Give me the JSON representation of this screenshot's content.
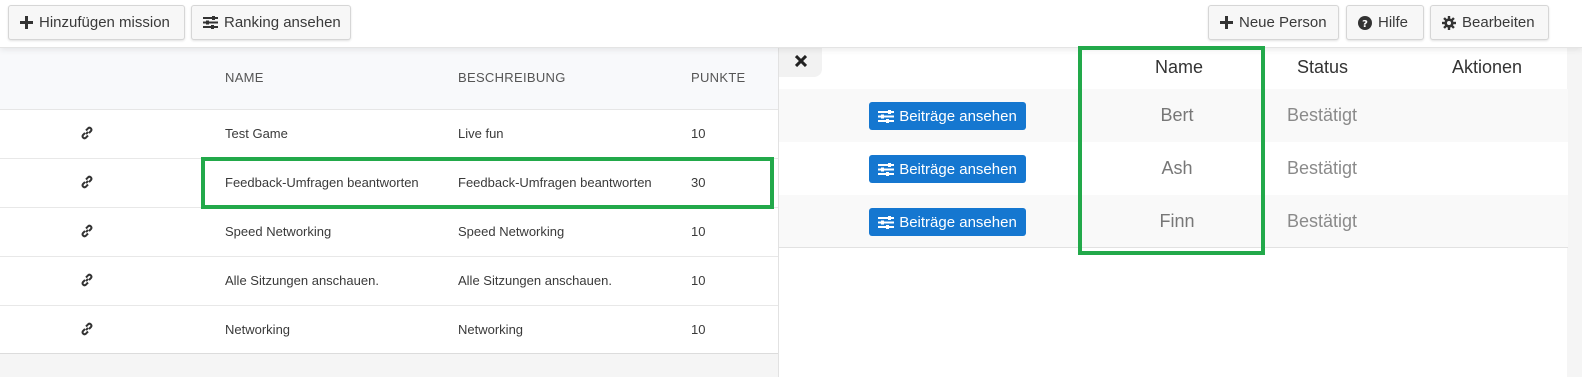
{
  "toolbar": {
    "add_mission_label": "Hinzufügen mission",
    "ranking_label": "Ranking ansehen",
    "new_person_label": "Neue Person",
    "help_label": "Hilfe",
    "edit_label": "Bearbeiten"
  },
  "missions_table": {
    "headers": {
      "name": "NAME",
      "description": "BESCHREIBUNG",
      "points": "PUNKTE"
    },
    "rows": [
      {
        "name": "Test Game",
        "description": "Live fun",
        "points": "10"
      },
      {
        "name": "Feedback-Umfragen beantworten",
        "description": "Feedback-Umfragen beantworten",
        "points": "30"
      },
      {
        "name": "Speed Networking",
        "description": "Speed Networking",
        "points": "10"
      },
      {
        "name": "Alle Sitzungen anschauen.",
        "description": "Alle Sitzungen anschauen.",
        "points": "10"
      },
      {
        "name": "Networking",
        "description": "Networking",
        "points": "10"
      }
    ]
  },
  "participants_table": {
    "headers": {
      "name": "Name",
      "status": "Status",
      "actions": "Aktionen"
    },
    "view_contributions_label": "Beiträge ansehen",
    "rows": [
      {
        "name": "Bert",
        "status": "Bestätigt"
      },
      {
        "name": "Ash",
        "status": "Bestätigt"
      },
      {
        "name": "Finn",
        "status": "Bestätigt"
      }
    ]
  },
  "colors": {
    "primary_button": "#1577d0",
    "highlight": "#22a94a"
  },
  "icons": {
    "add": "plus-icon",
    "ranking": "sliders-icon",
    "help": "question-circle-icon",
    "edit": "gear-icon",
    "row_link": "link-icon",
    "close": "close-icon"
  }
}
